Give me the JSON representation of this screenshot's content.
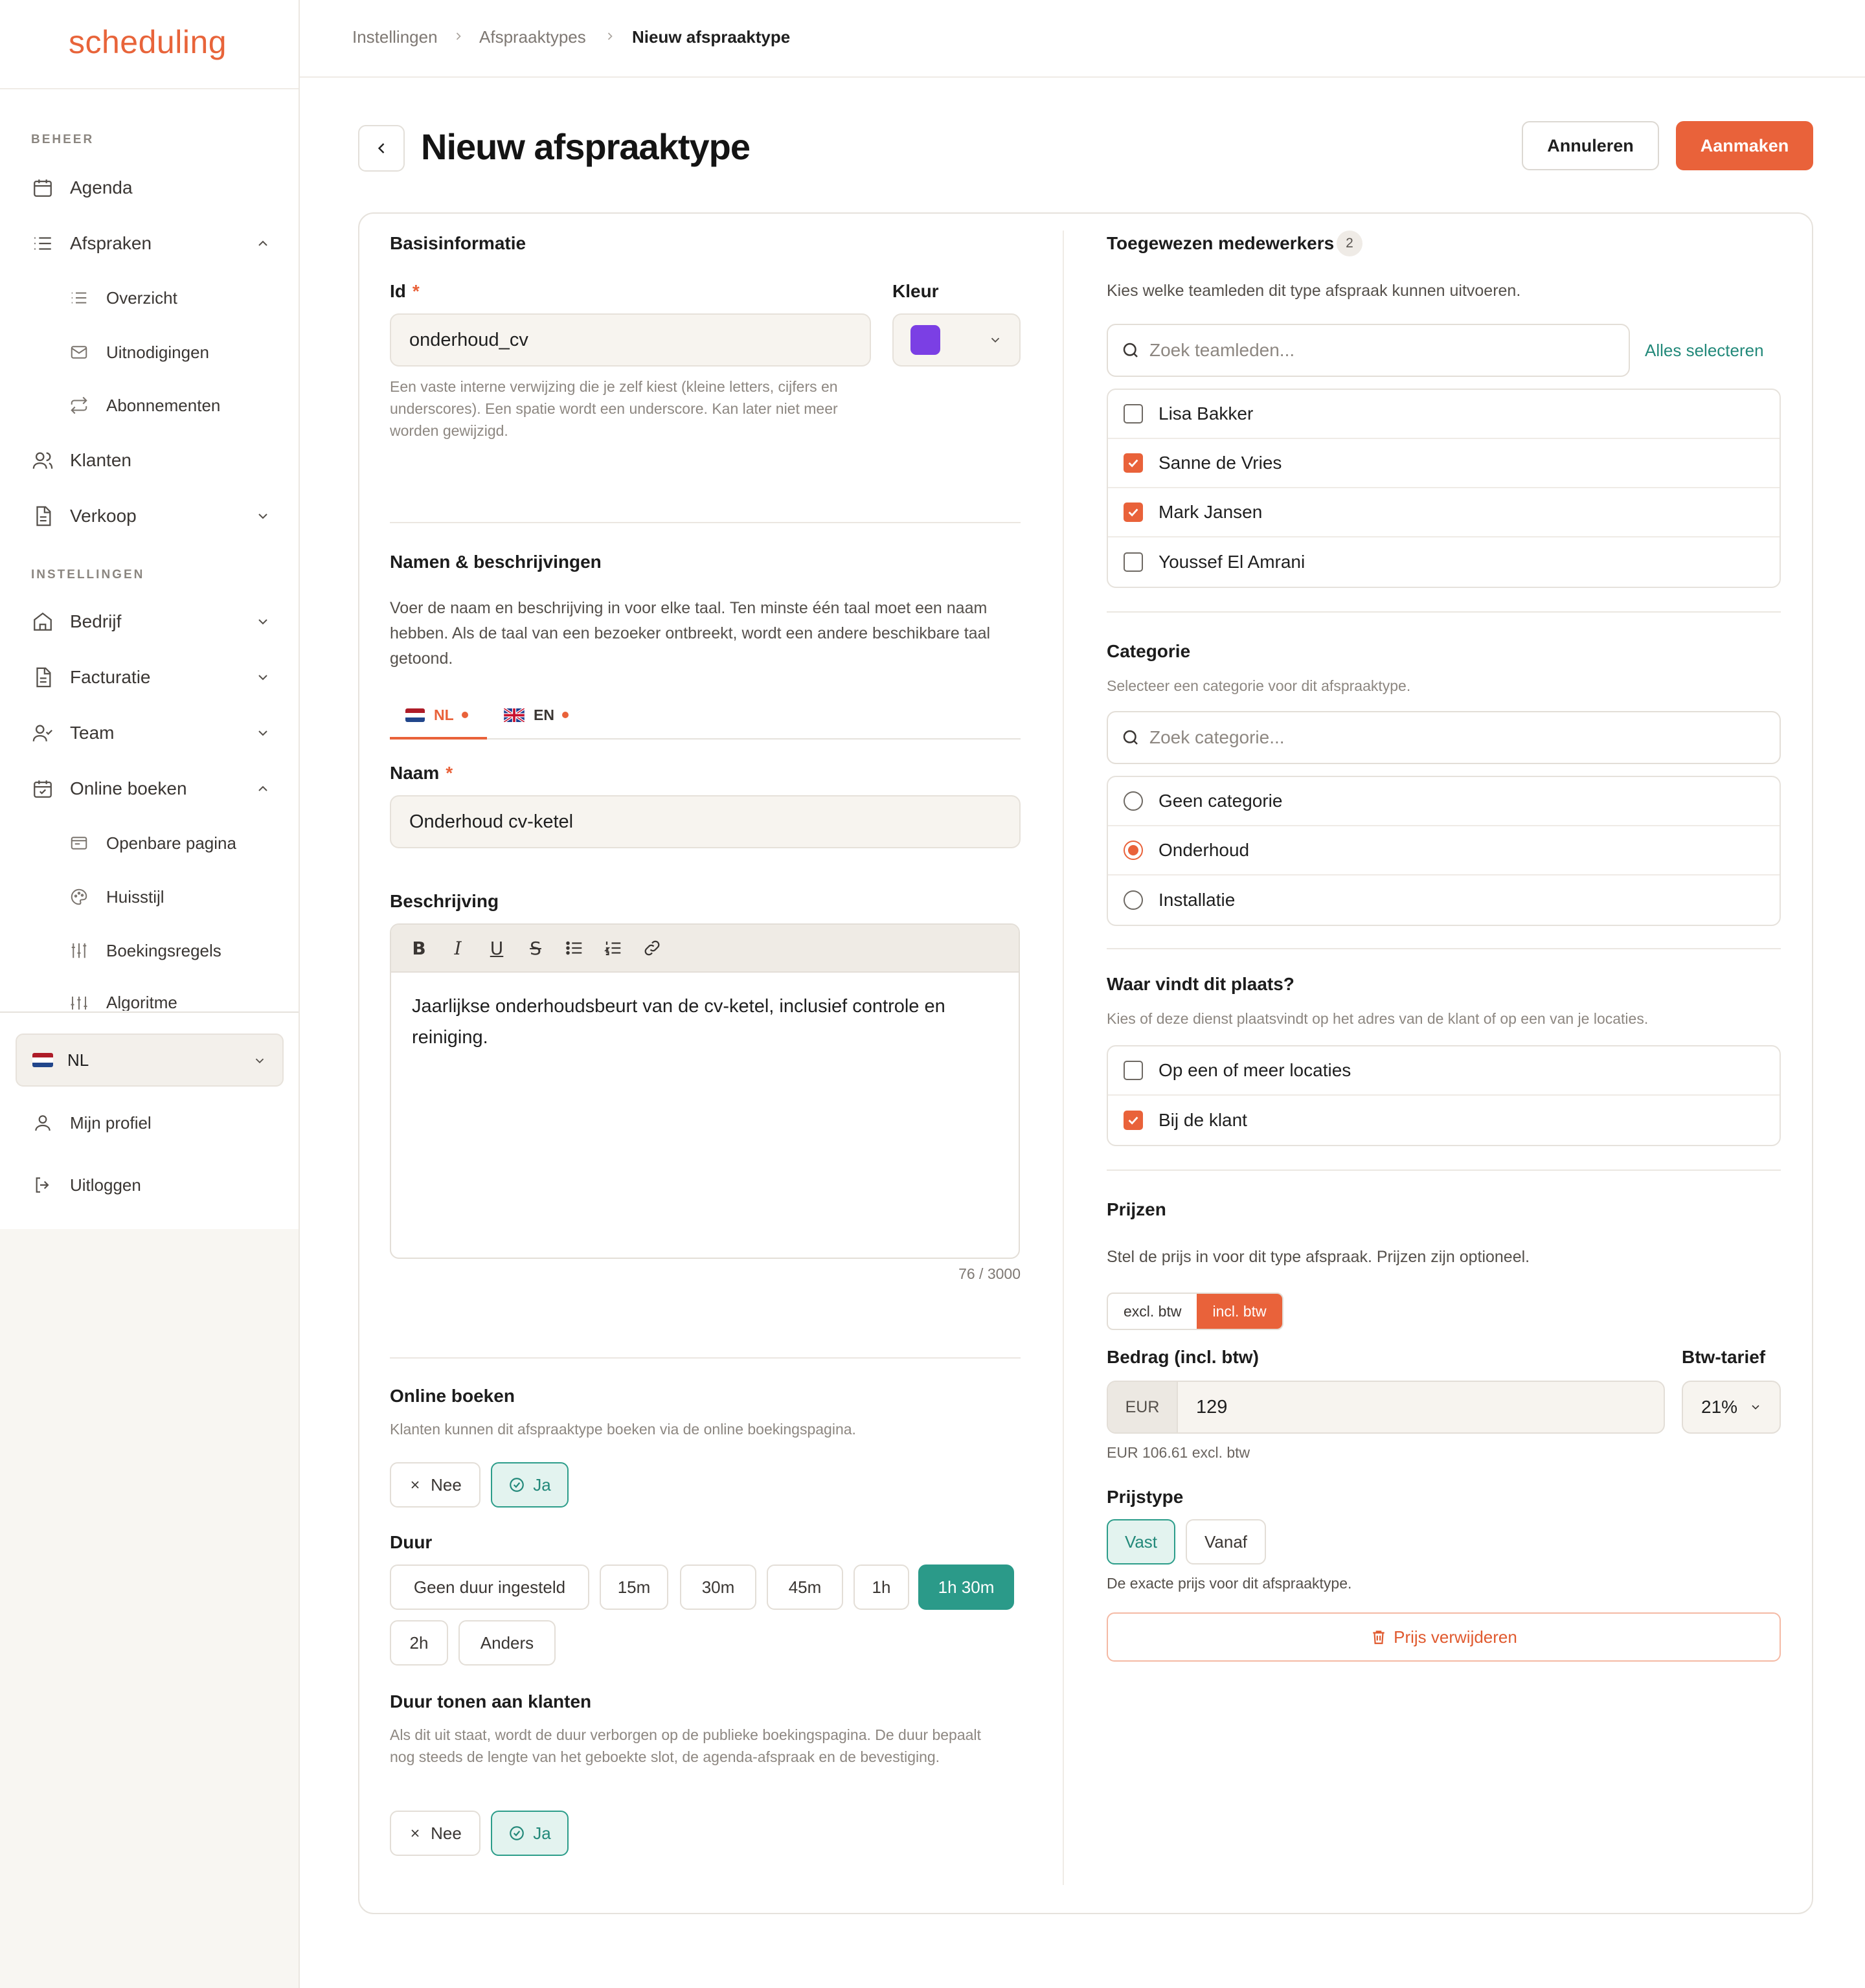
{
  "app": {
    "logo": "scheduling"
  },
  "sidebar": {
    "section_manage": "BEHEER",
    "section_settings": "INSTELLINGEN",
    "items": {
      "agenda": "Agenda",
      "afspraken": "Afspraken",
      "overzicht": "Overzicht",
      "uitnodigingen": "Uitnodigingen",
      "abonnementen": "Abonnementen",
      "klanten": "Klanten",
      "verkoop": "Verkoop",
      "bedrijf": "Bedrijf",
      "facturatie": "Facturatie",
      "team": "Team",
      "online_boeken": "Online boeken",
      "openbare_pagina": "Openbare pagina",
      "huisstijl": "Huisstijl",
      "boekingsregels": "Boekingsregels",
      "algoritme": "Algoritme"
    },
    "language": "NL",
    "profile": "Mijn profiel",
    "logout": "Uitloggen"
  },
  "breadcrumb": [
    "Instellingen",
    "Afspraaktypes",
    "Nieuw afspraaktype"
  ],
  "header": {
    "title": "Nieuw afspraaktype",
    "cancel": "Annuleren",
    "create": "Aanmaken"
  },
  "basic": {
    "title": "Basisinformatie",
    "id_label": "Id",
    "id_value": "onderhoud_cv",
    "id_help": "Een vaste interne verwijzing die je zelf kiest (kleine letters, cijfers en underscores). Een spatie wordt een underscore. Kan later niet meer worden gewijzigd.",
    "color_label": "Kleur",
    "color_value": "#7b3fe4"
  },
  "names": {
    "title": "Namen & beschrijvingen",
    "help": "Voer de naam en beschrijving in voor elke taal. Ten minste één taal moet een naam hebben. Als de taal van een bezoeker ontbreekt, wordt een andere beschikbare taal getoond.",
    "tabs": [
      "NL",
      "EN"
    ],
    "name_label": "Naam",
    "name_value": "Onderhoud cv-ketel",
    "desc_label": "Beschrijving",
    "desc_value": "Jaarlijkse onderhoudsbeurt van de cv-ketel, inclusief controle en reiniging.",
    "char_count": "76 / 3000"
  },
  "online": {
    "title": "Online boeken",
    "help": "Klanten kunnen dit afspraaktype boeken via de online boekingspagina.",
    "no": "Nee",
    "yes": "Ja",
    "duration_label": "Duur",
    "durations": [
      "Geen duur ingesteld",
      "15m",
      "30m",
      "45m",
      "1h",
      "1h 30m",
      "2h",
      "Anders"
    ],
    "selected_duration": "1h 30m",
    "show_duration_title": "Duur tonen aan klanten",
    "show_duration_help": "Als dit uit staat, wordt de duur verborgen op de publieke boekingspagina. De duur bepaalt nog steeds de lengte van het geboekte slot, de agenda-afspraak en de bevestiging."
  },
  "staff": {
    "title": "Toegewezen medewerkers",
    "count": "2",
    "help": "Kies welke teamleden dit type afspraak kunnen uitvoeren.",
    "search_placeholder": "Zoek teamleden...",
    "select_all": "Alles selecteren",
    "members": [
      {
        "name": "Lisa Bakker",
        "checked": false
      },
      {
        "name": "Sanne de Vries",
        "checked": true
      },
      {
        "name": "Mark Jansen",
        "checked": true
      },
      {
        "name": "Youssef El Amrani",
        "checked": false
      }
    ]
  },
  "category": {
    "title": "Categorie",
    "help": "Selecteer een categorie voor dit afspraaktype.",
    "search_placeholder": "Zoek categorie...",
    "options": [
      "Geen categorie",
      "Onderhoud",
      "Installatie"
    ],
    "selected": "Onderhoud"
  },
  "location": {
    "title": "Waar vindt dit plaats?",
    "help": "Kies of deze dienst plaatsvindt op het adres van de klant of op een van je locaties.",
    "options": [
      {
        "label": "Op een of meer locaties",
        "checked": false
      },
      {
        "label": "Bij de klant",
        "checked": true
      }
    ]
  },
  "prices": {
    "title": "Prijzen",
    "help": "Stel de prijs in voor dit type afspraak. Prijzen zijn optioneel.",
    "toggle": [
      "excl. btw",
      "incl. btw"
    ],
    "toggle_active": "incl. btw",
    "amount_label": "Bedrag (incl. btw)",
    "currency": "EUR",
    "amount": "129",
    "vat_label": "Btw-tarief",
    "vat": "21%",
    "excl_note": "EUR 106.61 excl. btw",
    "type_label": "Prijstype",
    "types": [
      "Vast",
      "Vanaf"
    ],
    "type_selected": "Vast",
    "type_help": "De exacte prijs voor dit afspraaktype.",
    "delete": "Prijs verwijderen"
  },
  "colors": {
    "accent": "#e9623a",
    "teal": "#2b9a89"
  }
}
